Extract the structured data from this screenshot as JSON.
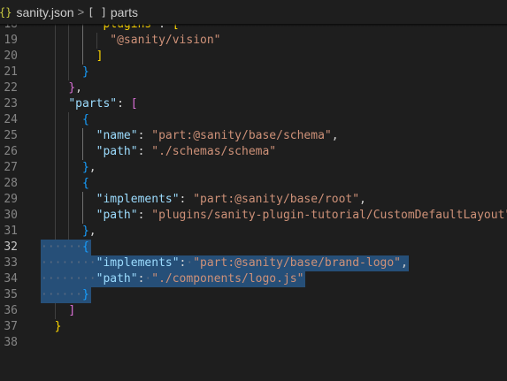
{
  "breadcrumb": {
    "file_icon": "{}",
    "file": "sanity.json",
    "separator": ">",
    "node_icon": "[ ]",
    "node": "parts"
  },
  "editor": {
    "current_line": 32,
    "colors": {
      "background": "#1e1e1e",
      "key": "#9cdcfe",
      "string": "#ce9178",
      "punctuation": "#d4d4d4",
      "bracket_gold": "#ffd700",
      "bracket_orchid": "#da70d6",
      "bracket_blue": "#179fff",
      "selection": "#264f78",
      "line_number": "#858585"
    },
    "lines": [
      {
        "n": "18",
        "tokens": [
          {
            "c": "b1",
            "t": "\"plugins\""
          },
          {
            "c": "p",
            "t": ": "
          },
          {
            "c": "b1",
            "t": "["
          }
        ]
      },
      {
        "n": "19",
        "tokens": [
          {
            "c": "s",
            "t": "\"@sanity/vision\""
          }
        ]
      },
      {
        "n": "20",
        "tokens": [
          {
            "c": "b1",
            "t": "]"
          }
        ]
      },
      {
        "n": "21",
        "tokens": [
          {
            "c": "b3",
            "t": "}"
          }
        ]
      },
      {
        "n": "22",
        "tokens": [
          {
            "c": "b2",
            "t": "}"
          },
          {
            "c": "p",
            "t": ","
          }
        ]
      },
      {
        "n": "23",
        "tokens": [
          {
            "c": "k",
            "t": "\"parts\""
          },
          {
            "c": "p",
            "t": ": "
          },
          {
            "c": "b2",
            "t": "["
          }
        ]
      },
      {
        "n": "24",
        "tokens": [
          {
            "c": "b3",
            "t": "{"
          }
        ]
      },
      {
        "n": "25",
        "tokens": [
          {
            "c": "k",
            "t": "\"name\""
          },
          {
            "c": "p",
            "t": ": "
          },
          {
            "c": "s",
            "t": "\"part:@sanity/base/schema\""
          },
          {
            "c": "p",
            "t": ","
          }
        ]
      },
      {
        "n": "26",
        "tokens": [
          {
            "c": "k",
            "t": "\"path\""
          },
          {
            "c": "p",
            "t": ": "
          },
          {
            "c": "s",
            "t": "\"./schemas/schema\""
          }
        ]
      },
      {
        "n": "27",
        "tokens": [
          {
            "c": "b3",
            "t": "}"
          },
          {
            "c": "p",
            "t": ","
          }
        ]
      },
      {
        "n": "28",
        "tokens": [
          {
            "c": "b3",
            "t": "{"
          }
        ]
      },
      {
        "n": "29",
        "tokens": [
          {
            "c": "k",
            "t": "\"implements\""
          },
          {
            "c": "p",
            "t": ": "
          },
          {
            "c": "s",
            "t": "\"part:@sanity/base/root\""
          },
          {
            "c": "p",
            "t": ","
          }
        ]
      },
      {
        "n": "30",
        "tokens": [
          {
            "c": "k",
            "t": "\"path\""
          },
          {
            "c": "p",
            "t": ": "
          },
          {
            "c": "s",
            "t": "\"plugins/sanity-plugin-tutorial/CustomDefaultLayout\""
          }
        ]
      },
      {
        "n": "31",
        "tokens": [
          {
            "c": "b3",
            "t": "}"
          },
          {
            "c": "p",
            "t": ","
          }
        ]
      },
      {
        "n": "32",
        "tokens": [
          {
            "c": "b3",
            "t": "{"
          }
        ]
      },
      {
        "n": "33",
        "tokens": [
          {
            "c": "k",
            "t": "\"implements\""
          },
          {
            "c": "p",
            "t": ": "
          },
          {
            "c": "s",
            "t": "\"part:@sanity/base/brand-logo\""
          },
          {
            "c": "p",
            "t": ","
          }
        ]
      },
      {
        "n": "34",
        "tokens": [
          {
            "c": "k",
            "t": "\"path\""
          },
          {
            "c": "p",
            "t": ": "
          },
          {
            "c": "s",
            "t": "\"./components/logo.js\""
          }
        ]
      },
      {
        "n": "35",
        "tokens": [
          {
            "c": "b3",
            "t": "}"
          }
        ]
      },
      {
        "n": "36",
        "tokens": [
          {
            "c": "b2",
            "t": "]"
          }
        ]
      },
      {
        "n": "37",
        "tokens": [
          {
            "c": "b1",
            "t": "}"
          }
        ]
      },
      {
        "n": "38",
        "tokens": []
      }
    ]
  }
}
